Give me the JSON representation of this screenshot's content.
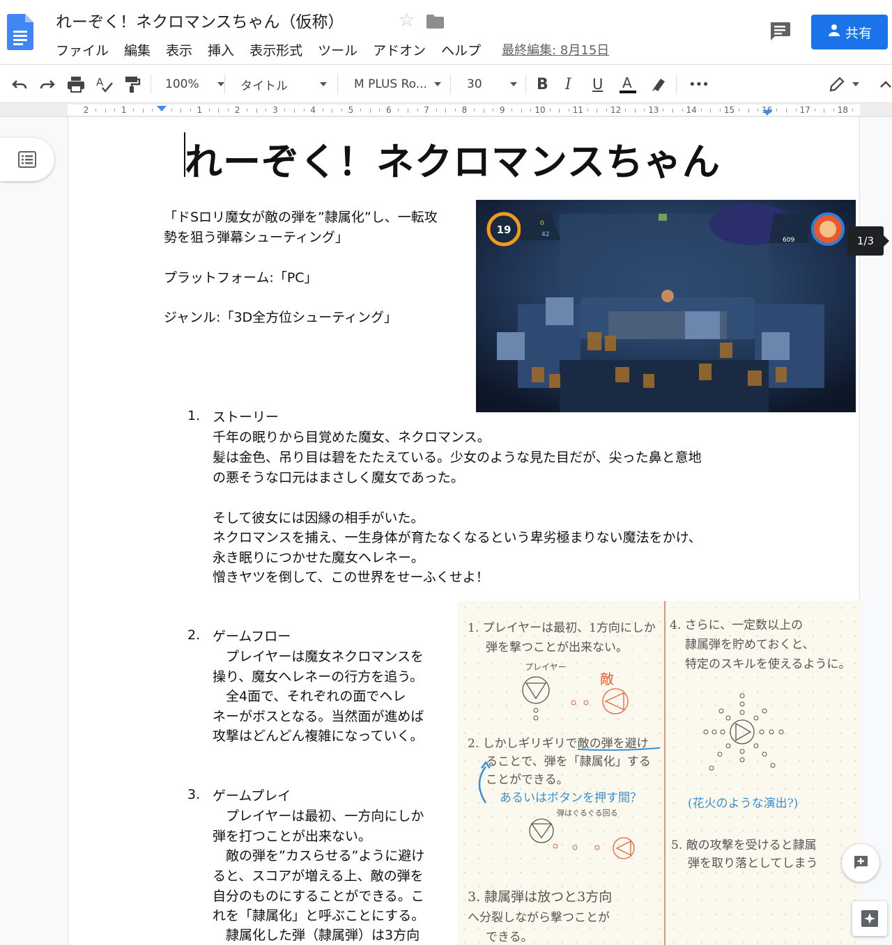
{
  "header": {
    "doc_title": "れーぞく！ネクロマンスちゃん（仮称）",
    "menu": [
      "ファイル",
      "編集",
      "表示",
      "挿入",
      "表示形式",
      "ツール",
      "アドオン",
      "ヘルプ"
    ],
    "last_edit": "最終編集: 8月15日",
    "share_label": "共有"
  },
  "toolbar": {
    "zoom": "100%",
    "style": "タイトル",
    "font": "M PLUS Ro...",
    "font_size": "30",
    "more": "•••"
  },
  "ruler": {
    "left_numbers": [
      "2",
      "1"
    ],
    "right_numbers": [
      "1",
      "2",
      "3",
      "4",
      "5",
      "6",
      "7",
      "8",
      "9",
      "10",
      "11",
      "12",
      "13",
      "14",
      "15",
      "16",
      "17",
      "18"
    ]
  },
  "document": {
    "heading": "れーぞく！ネクロマンスちゃん",
    "intro_line1": "「ドSロリ魔女が敵の弾を”隷属化”し、一転攻",
    "intro_line2": "勢を狙う弾幕シューティング」",
    "platform": "プラットフォーム:「PC」",
    "genre": "ジャンル:「3D全方位シューティング」",
    "image_counter": "1/3",
    "game_hud": {
      "lives": "19",
      "coins": "0",
      "stars": "42",
      "score": "609"
    },
    "sections": [
      {
        "number": "1.",
        "title": "ストーリー",
        "lines": [
          "千年の眠りから目覚めた魔女、ネクロマンス。",
          "髪は金色、吊り目は碧をたたえている。少女のような見た目だが、尖った鼻と意地",
          "の悪そうな口元はまさしく魔女であった。",
          "",
          "そして彼女には因縁の相手がいた。",
          "ネクロマンスを捕え、一生身体が育たなくなるという卑劣極まりない魔法をかけ、",
          "永き眠りにつかせた魔女ヘレネー。",
          "憎きヤツを倒して、この世界をせーふくせよ！"
        ]
      },
      {
        "number": "2.",
        "title": "ゲームフロー",
        "lines": [
          "　プレイヤーは魔女ネクロマンスを",
          "操り、魔女ヘレネーの行方を追う。",
          "　全4面で、それぞれの面でヘレ",
          "ネーがボスとなる。当然面が進めば",
          "攻撃はどんどん複雑になっていく。"
        ]
      },
      {
        "number": "3.",
        "title": "ゲームプレイ",
        "lines": [
          "　プレイヤーは最初、一方向にしか",
          "弾を打つことが出来ない。",
          "　敵の弾を”カスらせる”ように避け",
          "ると、スコアが増える上、敵の弾を",
          "自分のものにすることができる。こ",
          "れを「隷属化」と呼ぶことにする。",
          "　隷属化した弾（隷属弾）は3方向"
        ]
      }
    ],
    "sketch": {
      "note1_line1": "1. プレイヤーは最初、1方向にしか",
      "note1_line2": "弾を撃つことが出来ない。",
      "player_label": "プレイヤー",
      "enemy_label": "敵",
      "note2_line1": "2. しかしギリギリで敵の弾を避け",
      "note2_line2": "ることで、弾を「隷属化」する",
      "note2_line3": "ことができる。",
      "note2_blue": "あるいはボタンを押す間？",
      "note2_small": "弾はぐるぐる回る",
      "note3_line1": "3. 隷属弾は放つと3方向",
      "note3_line2": "へ分裂しながら撃つことが",
      "note3_line3": "できる。",
      "note4_line1": "4. さらに、一定数以上の",
      "note4_line2": "隷属弾を貯めておくと、",
      "note4_line3": "特定のスキルを使えるように。",
      "note4_blue": "(花火のような演出?)",
      "note5_line1": "5. 敵の攻撃を受けると隷属",
      "note5_line2": "弾を取り落としてしまう"
    }
  },
  "colors": {
    "share_blue": "#1a73e8",
    "sketch_orange": "#e8603c",
    "sketch_blue": "#3a8fd0"
  }
}
